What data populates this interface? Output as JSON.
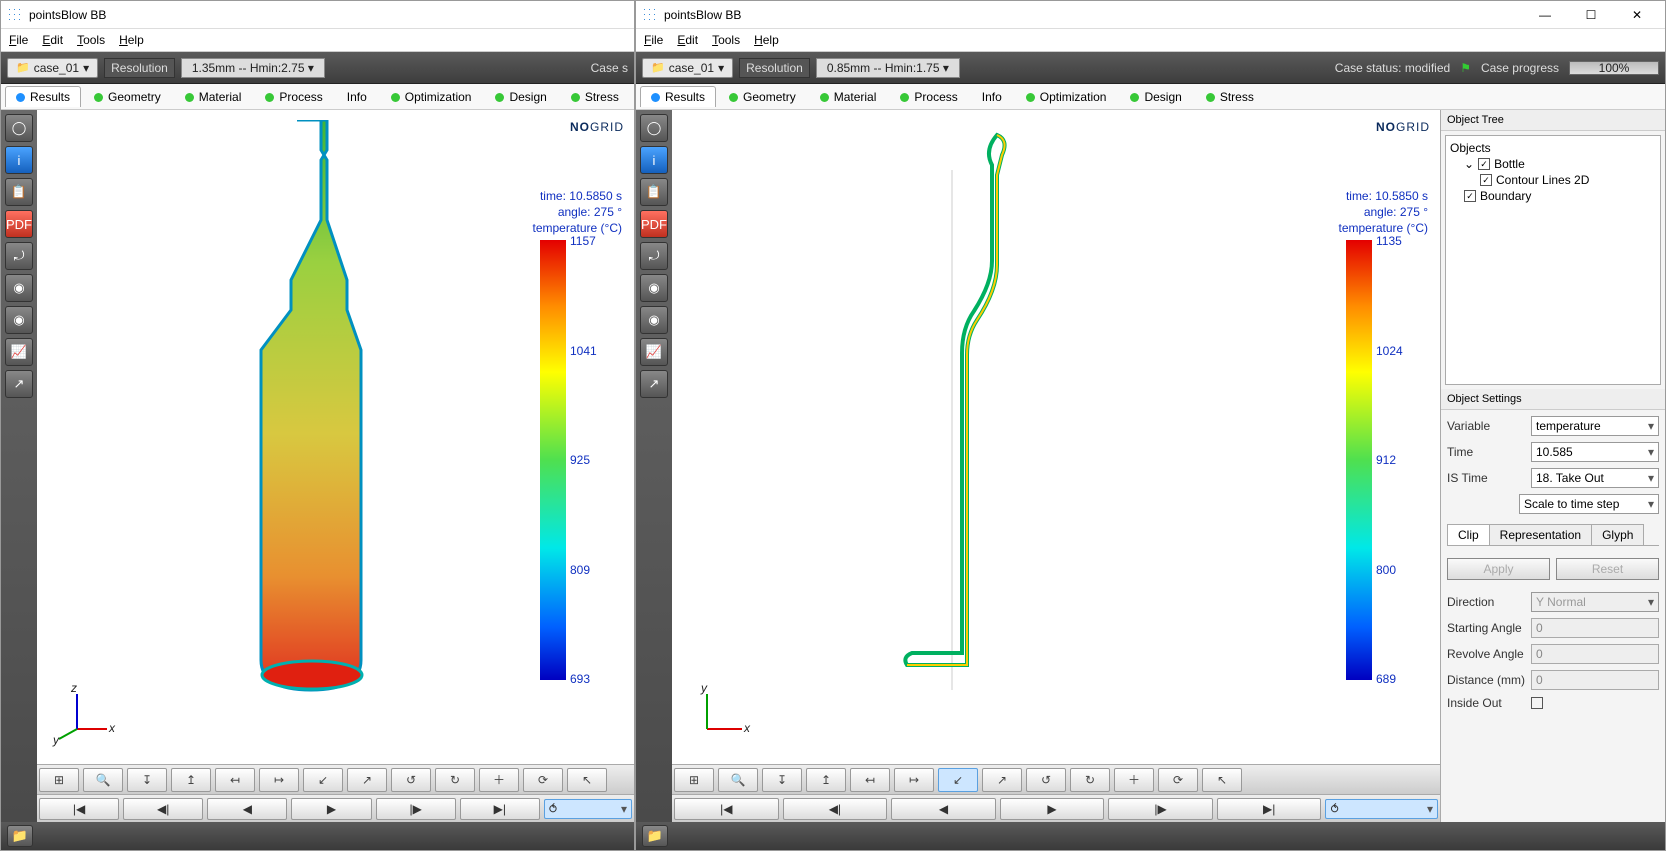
{
  "app_title": "pointsBlow BB",
  "menu": {
    "file": "File",
    "edit": "Edit",
    "tools": "Tools",
    "help": "Help"
  },
  "case_name": "case_01",
  "resolution_label": "Resolution",
  "left": {
    "resolution_value": "1.35mm -- Hmin:2.75",
    "status_trunc": "Case s",
    "info": {
      "time": "time: 10.5850 s",
      "angle": "angle: 275 °",
      "temp": "temperature (°C)"
    },
    "scale": [
      "1157",
      "1041",
      "925",
      "809",
      "693"
    ],
    "axes": {
      "a": "z",
      "b": "x",
      "c": "y"
    }
  },
  "right": {
    "resolution_value": "0.85mm -- Hmin:1.75",
    "status_text": "Case status: modified",
    "progress_text": "Case progress",
    "progress_pct": "100%",
    "info": {
      "time": "time: 10.5850 s",
      "angle": "angle: 275 °",
      "temp": "temperature (°C)"
    },
    "scale": [
      "1135",
      "1024",
      "912",
      "800",
      "689"
    ],
    "axes": {
      "a": "y",
      "b": "x"
    }
  },
  "tabs": [
    "Results",
    "Geometry",
    "Material",
    "Process",
    "Info",
    "Optimization",
    "Design",
    "Stress"
  ],
  "logo": {
    "no": "NO",
    "grid": "GRID"
  },
  "object_tree": {
    "title": "Object Tree",
    "root": "Objects",
    "bottle": "Bottle",
    "contour": "Contour Lines 2D",
    "boundary": "Boundary"
  },
  "settings": {
    "title": "Object Settings",
    "variable_label": "Variable",
    "variable_value": "temperature",
    "time_label": "Time",
    "time_value": "10.585",
    "is_label": "IS Time",
    "is_value": "18. Take Out",
    "scale_btn": "Scale to time step",
    "tabs": [
      "Clip",
      "Representation",
      "Glyph"
    ],
    "apply": "Apply",
    "reset": "Reset",
    "direction_label": "Direction",
    "direction_value": "Y Normal",
    "start_label": "Starting Angle",
    "start_value": "0",
    "rev_label": "Revolve Angle",
    "rev_value": "0",
    "dist_label": "Distance (mm)",
    "dist_value": "0",
    "inside_label": "Inside Out"
  },
  "chart_data": [
    {
      "type": "heatmap",
      "title": "temperature (°C) — 3D bottle, 1.35mm",
      "time_s": 10.585,
      "angle_deg": 275,
      "colorbar_range": [
        693,
        1157
      ],
      "ticks": [
        693,
        809,
        925,
        1041,
        1157
      ]
    },
    {
      "type": "heatmap",
      "title": "temperature (°C) — 2D contour, 0.85mm",
      "time_s": 10.585,
      "angle_deg": 275,
      "colorbar_range": [
        689,
        1135
      ],
      "ticks": [
        689,
        800,
        912,
        1024,
        1135
      ]
    }
  ]
}
